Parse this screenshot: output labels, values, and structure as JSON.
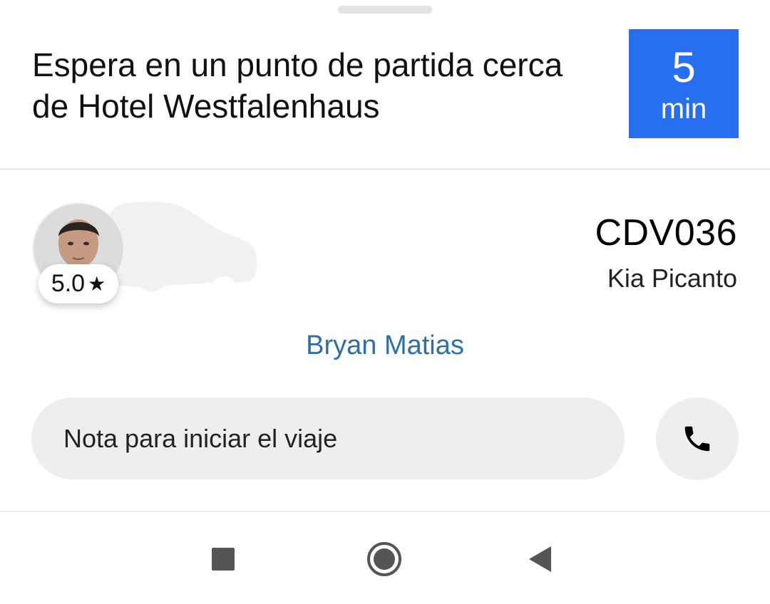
{
  "header": {
    "instruction": "Espera en un punto de partida cerca de Hotel Westfalenhaus",
    "eta_value": "5",
    "eta_unit": "min"
  },
  "driver": {
    "rating": "5.0",
    "rating_icon": "star-icon",
    "name": "Bryan Matias"
  },
  "vehicle": {
    "plate": "CDV036",
    "model": "Kia Picanto"
  },
  "note": {
    "placeholder": "Nota para iniciar el viaje"
  },
  "actions": {
    "call_icon": "phone-icon"
  },
  "navbar": {
    "items": [
      "recents-square-icon",
      "home-circle-icon",
      "back-triangle-icon"
    ]
  },
  "colors": {
    "eta_background": "#276ef1",
    "driver_name": "#2e6fa5",
    "field_background": "#eeeeee"
  }
}
